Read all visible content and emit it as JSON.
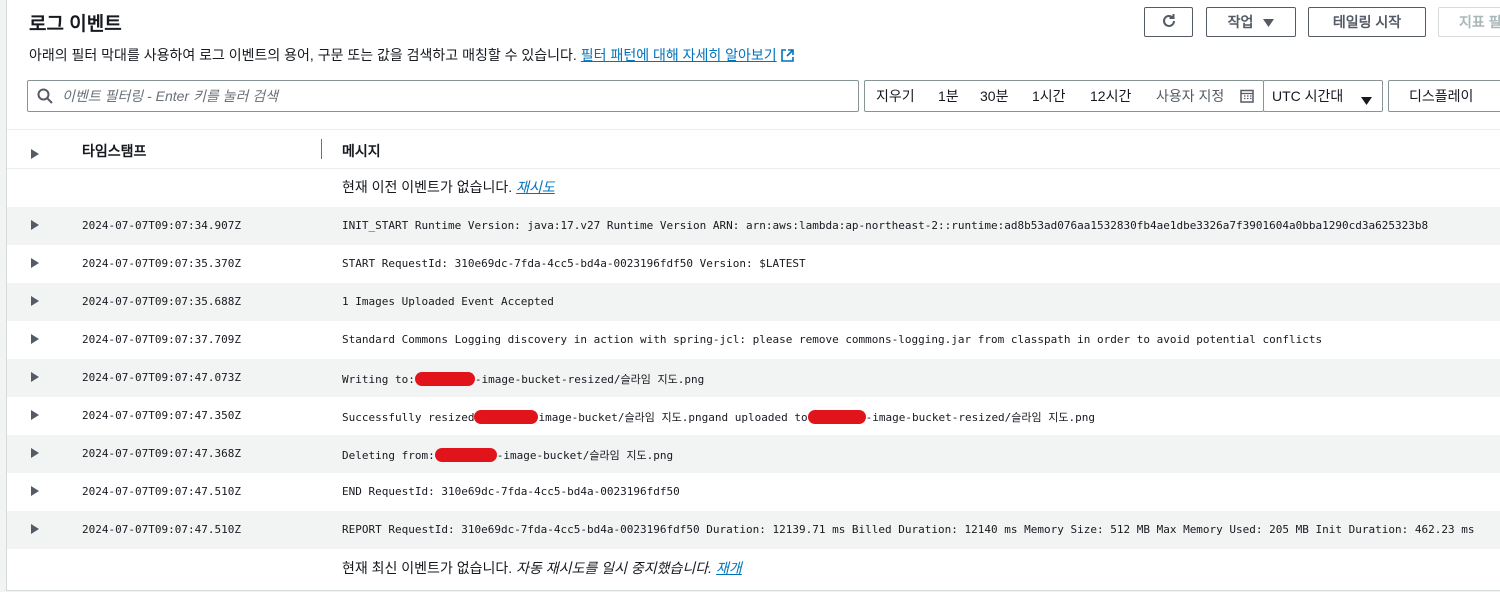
{
  "header": {
    "title": "로그 이벤트",
    "description": "아래의 필터 막대를 사용하여 로그 이벤트의 용어, 구문 또는 값을 검색하고 매칭할 수 있습니다.",
    "learn_more_link": "필터 패턴에 대해 자세히 알아보기"
  },
  "toolbar": {
    "refresh_icon": "refresh-icon",
    "actions_label": "작업",
    "tail_label": "테일링 시작",
    "metric_filter_label": "지표 필"
  },
  "filter": {
    "placeholder": "이벤트 필터링 - Enter 키를 눌러 검색",
    "value": ""
  },
  "time_range": {
    "clear": "지우기",
    "options": [
      "1분",
      "30분",
      "1시간",
      "12시간"
    ],
    "custom": "사용자 지정"
  },
  "timezone": {
    "selected": "UTC 시간대"
  },
  "display": {
    "label": "디스플레이"
  },
  "table": {
    "columns": [
      "타임스탬프",
      "메시지"
    ],
    "top_notice": {
      "text": "현재 이전 이벤트가 없습니다.",
      "retry_link": "재시도"
    },
    "rows": [
      {
        "timestamp": "2024-07-07T09:07:34.907Z",
        "message": "INIT_START Runtime Version: java:17.v27 Runtime Version ARN: arn:aws:lambda:ap-northeast-2::runtime:ad8b53ad076aa1532830fb4ae1dbe3326a7f3901604a0bba1290cd3a625323b8"
      },
      {
        "timestamp": "2024-07-07T09:07:35.370Z",
        "message": "START RequestId: 310e69dc-7fda-4cc5-bd4a-0023196fdf50 Version: $LATEST"
      },
      {
        "timestamp": "2024-07-07T09:07:35.688Z",
        "message": "1 Images Uploaded Event Accepted"
      },
      {
        "timestamp": "2024-07-07T09:07:37.709Z",
        "message": "Standard Commons Logging discovery in action with spring-jcl: please remove commons-logging.jar from classpath in order to avoid potential conflicts"
      },
      {
        "timestamp": "2024-07-07T09:07:47.073Z",
        "message_parts": [
          "Writing to:",
          "-image-bucket-resized/슬라임 지도.png"
        ]
      },
      {
        "timestamp": "2024-07-07T09:07:47.350Z",
        "message_parts": [
          "Successfully resized",
          "image-bucket/슬라임 지도.pngand uploaded to",
          "-image-bucket-resized/슬라임 지도.png"
        ]
      },
      {
        "timestamp": "2024-07-07T09:07:47.368Z",
        "message_parts": [
          "Deleting from:",
          "-image-bucket/슬라임 지도.png"
        ]
      },
      {
        "timestamp": "2024-07-07T09:07:47.510Z",
        "message": "END RequestId: 310e69dc-7fda-4cc5-bd4a-0023196fdf50"
      },
      {
        "timestamp": "2024-07-07T09:07:47.510Z",
        "message": "REPORT RequestId: 310e69dc-7fda-4cc5-bd4a-0023196fdf50 Duration: 12139.71 ms Billed Duration: 12140 ms Memory Size: 512 MB Max Memory Used: 205 MB Init Duration: 462.23 ms"
      }
    ],
    "bottom_notice": {
      "text": "현재 최신 이벤트가 없습니다.",
      "paused_text": "자동 재시도를 일시 중지했습니다.",
      "resume_link": "재개"
    }
  },
  "colors": {
    "link": "#0073bb",
    "redaction": "#e1141b",
    "stripe": "#f2f3f3"
  }
}
